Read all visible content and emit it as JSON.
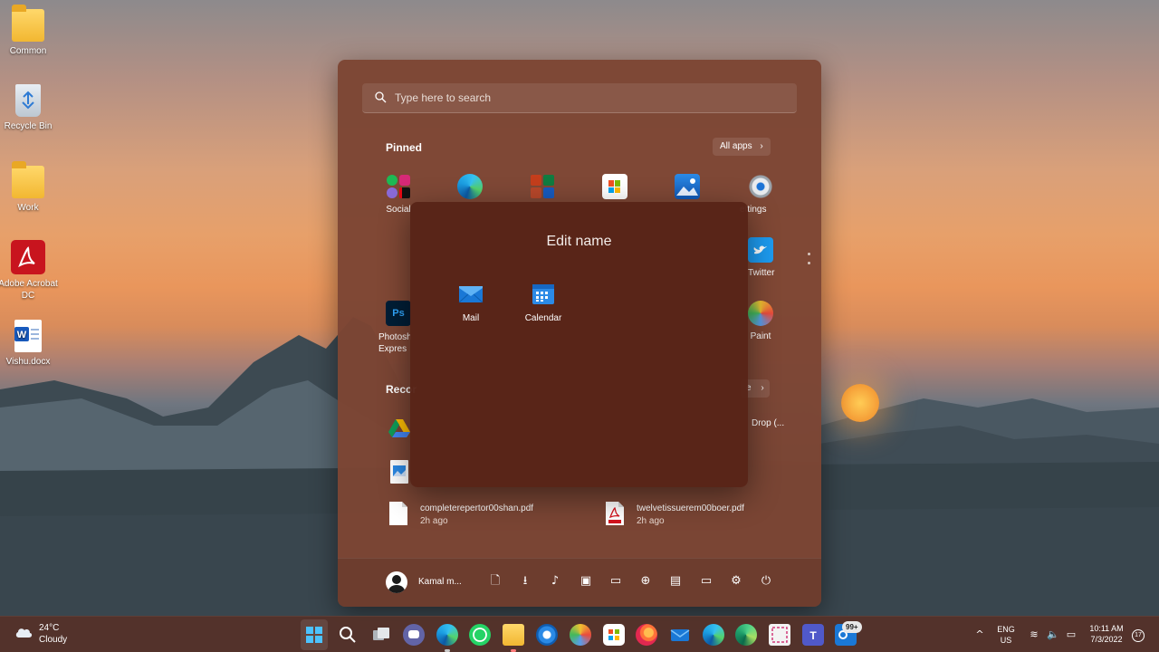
{
  "desktop": {
    "icons": [
      {
        "label": "Common",
        "icon": "folder-icon"
      },
      {
        "label": "Recycle Bin",
        "icon": "recycle-bin-icon"
      },
      {
        "label": "Work",
        "icon": "folder-icon"
      },
      {
        "label": "Adobe Acrobat DC",
        "icon": "acrobat-icon"
      },
      {
        "label": "Vishu.docx",
        "icon": "word-document-icon"
      }
    ]
  },
  "start_menu": {
    "search_placeholder": "Type here to search",
    "pinned_title": "Pinned",
    "all_apps_label": "All apps",
    "all_apps_chevron": "›",
    "pinned_apps": [
      {
        "label": "Social",
        "icon": "social-folder-icon"
      },
      {
        "label": "",
        "icon": "edge-icon"
      },
      {
        "label": "",
        "icon": "office-folder-icon"
      },
      {
        "label": "",
        "icon": "microsoft-store-icon"
      },
      {
        "label": "",
        "icon": "photos-icon"
      },
      {
        "label": "Settings",
        "visible_text": "ettings",
        "icon": "settings-icon"
      },
      {
        "label": "Twitter",
        "visible_text": "Twitter",
        "icon": "twitter-icon"
      },
      {
        "label": "Photoshop Express",
        "visible_text": "Photosh Expres",
        "icon": "photoshop-icon"
      },
      {
        "label": "Paint",
        "icon": "paint-icon"
      }
    ],
    "recommended_title_visible": "Recor",
    "more_label_visible": "e",
    "more_chevron": "›",
    "recommended": [
      {
        "name": "",
        "time": "",
        "icon": "google-drive-icon"
      },
      {
        "name": "",
        "time": "",
        "icon": "image-file-icon"
      },
      {
        "name": "Drop (...",
        "time": "",
        "icon": ""
      },
      {
        "name": "completerepertor00shan.pdf",
        "time": "2h ago",
        "icon": "pdf-file-icon"
      },
      {
        "name": "twelvetissuerem00boer.pdf",
        "time": "2h ago",
        "icon": "adobe-pdf-icon"
      }
    ],
    "user_name": "Kamal m...",
    "footer_glyphs": {
      "documents": "🗋",
      "downloads": "⭳",
      "music": "♪",
      "pictures": "▣",
      "videos": "▭",
      "network": "⊕",
      "personal_folder": "▤",
      "file_explorer": "▭",
      "settings": "⚙",
      "power": "⏻"
    }
  },
  "folder_popup": {
    "title": "Edit name",
    "apps": [
      {
        "label": "Mail",
        "icon": "mail-icon"
      },
      {
        "label": "Calendar",
        "icon": "calendar-icon"
      }
    ]
  },
  "taskbar": {
    "weather_temp": "24°C",
    "weather_condition": "Cloudy",
    "badge_count": "99+",
    "language_line1": "ENG",
    "language_line2": "US",
    "time": "10:11 AM",
    "date": "7/3/2022",
    "notification_count": "17",
    "tray_glyphs": {
      "chevron": "^",
      "wifi": "≋",
      "volume": "🔈",
      "battery": "▭"
    }
  },
  "colors": {
    "start_bg": "#7c4534",
    "popup_bg": "#582418",
    "taskbar_bg": "#54322a",
    "accent": "#0a7ae0"
  }
}
